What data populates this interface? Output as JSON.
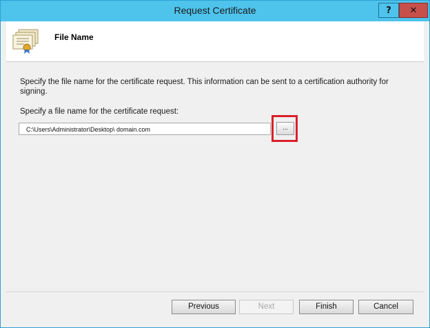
{
  "window": {
    "title": "Request Certificate",
    "help_label": "?",
    "close_label": "✕"
  },
  "header": {
    "title": "File Name",
    "icon": "certificate-icon"
  },
  "main": {
    "description": "Specify the file name for the certificate request. This information can be sent to a certification authority for signing.",
    "field_label": "Specify a file name for the certificate request:",
    "file_path": "C:\\Users\\Administrator\\Desktop\\ domain.com",
    "browse_label": "...",
    "highlight_color": "#d9202a"
  },
  "footer": {
    "previous_label": "Previous",
    "next_label": "Next",
    "finish_label": "Finish",
    "cancel_label": "Cancel"
  },
  "colors": {
    "titlebar": "#4ec3ec",
    "close_button": "#c7504b",
    "dialog_background": "#f0f0f0"
  }
}
